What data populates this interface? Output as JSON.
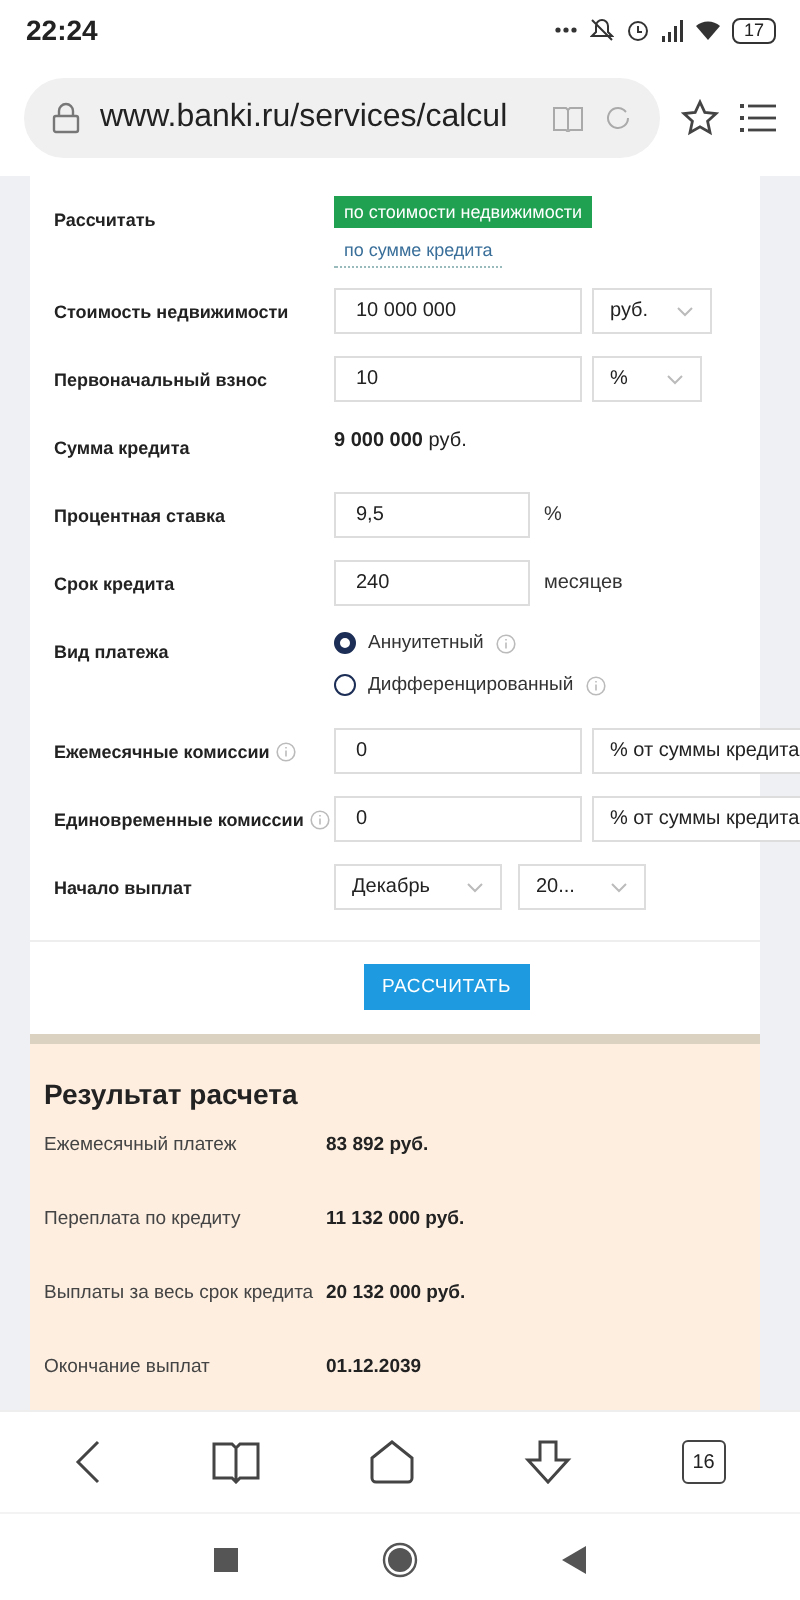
{
  "status_bar": {
    "time": "22:24",
    "battery": "17"
  },
  "browser": {
    "url": "www.banki.ru/services/calcul",
    "tab_count": "16"
  },
  "form": {
    "rows": [
      {
        "kind": "toggle",
        "label": "Рассчитать",
        "options": [
          {
            "label": "по стоимости недвижимости",
            "selected": true
          },
          {
            "label": "по сумме кредита",
            "selected": false
          }
        ]
      },
      {
        "kind": "input_select",
        "label": "Стоимость недвижимости",
        "value": "10 000 000",
        "select": "руб.",
        "caret": true
      },
      {
        "kind": "input_select",
        "label": "Первоначальный взнос",
        "value": "10",
        "select": "%",
        "caret": true
      },
      {
        "kind": "amount",
        "label": "Сумма кредита",
        "amount": "9 000 000",
        "unit": "руб."
      },
      {
        "kind": "input_unit",
        "label": "Процентная ставка",
        "value": "9,5",
        "unit": "%"
      },
      {
        "kind": "input_unit",
        "label": "Срок кредита",
        "value": "240",
        "unit": "месяцев"
      },
      {
        "kind": "radio",
        "label": "Вид платежа",
        "options": [
          {
            "label": "Аннуитетный",
            "selected": true
          },
          {
            "label": "Дифференцированный",
            "selected": false
          }
        ]
      },
      {
        "kind": "input_select",
        "label": "Ежемесячные комиссии",
        "info": true,
        "value": "0",
        "select": "% от суммы кредита",
        "caret": false
      },
      {
        "kind": "input_select",
        "label": "Единовременные комиссии",
        "info": true,
        "value": "0",
        "select": "% от суммы кредита",
        "caret": false
      },
      {
        "kind": "selects",
        "label": "Начало выплат",
        "selects": [
          "Декабрь",
          "20..."
        ]
      }
    ],
    "submit": "РАССЧИТАТЬ"
  },
  "result": {
    "title": "Результат расчета",
    "rows": [
      {
        "label": "Ежемесячный платеж",
        "value": "83 892 руб."
      },
      {
        "label": "Переплата по кредиту",
        "value": "11 132 000 руб."
      },
      {
        "label": "Выплаты за весь срок кредита",
        "value": "20 132 000 руб."
      },
      {
        "label": "Окончание выплат",
        "value": "01.12.2039"
      }
    ]
  }
}
